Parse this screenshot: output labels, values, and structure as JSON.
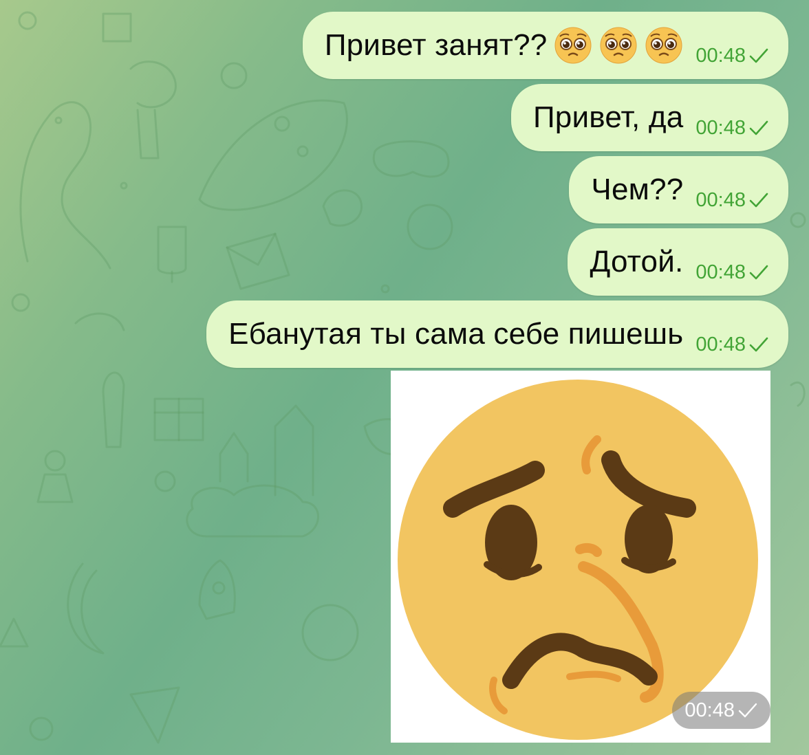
{
  "messages": [
    {
      "text": "Привет занят??",
      "emoji": [
        "pleading-face",
        "pleading-face",
        "pleading-face"
      ],
      "time": "00:48",
      "status": "read-check"
    },
    {
      "text": "Привет, да",
      "time": "00:48",
      "status": "read-check"
    },
    {
      "text": "Чем??",
      "time": "00:48",
      "status": "read-check"
    },
    {
      "text": "Дотой.",
      "time": "00:48",
      "status": "read-check"
    },
    {
      "text": "Ебанутая ты сама себе пишешь",
      "time": "00:48",
      "status": "read-check"
    }
  ],
  "image_message": {
    "content": "sad-face-sticker",
    "time": "00:48",
    "status": "read-check"
  },
  "colors": {
    "bubble": "#e2f8c8",
    "time_outgoing": "#42a436",
    "text": "#0b0b0b",
    "sticker_face": "#f2c561"
  }
}
